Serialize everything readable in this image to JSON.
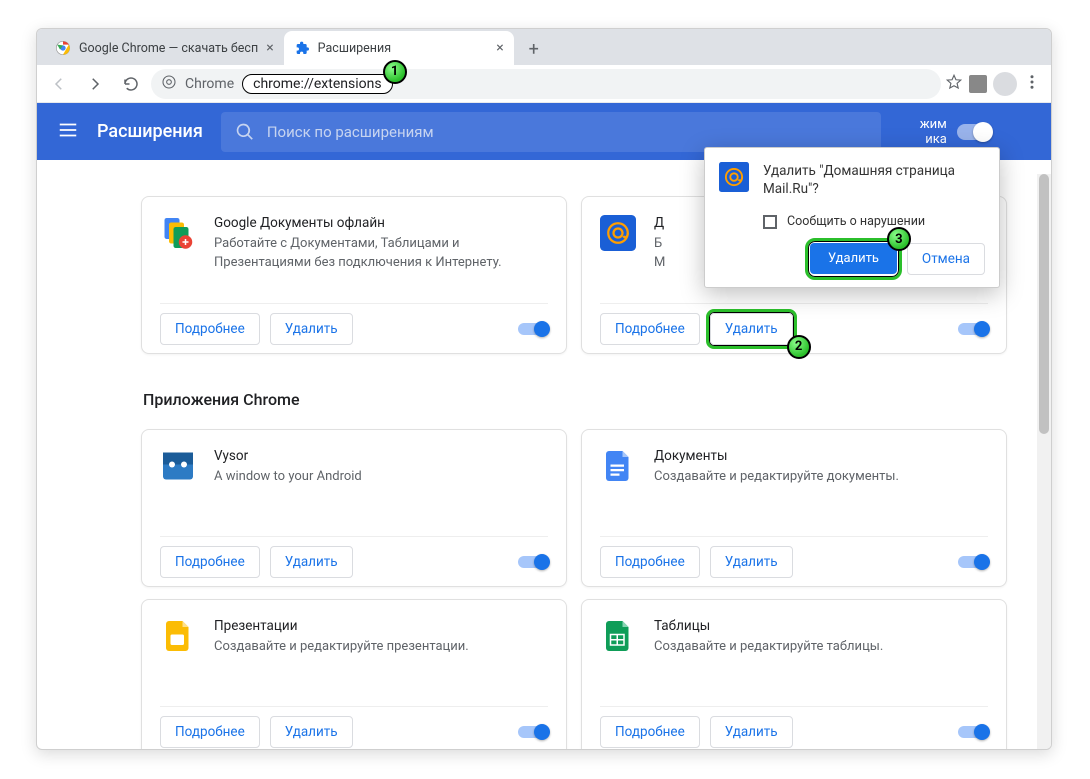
{
  "window": {
    "minimize": "–",
    "maximize": "▢",
    "close": "✕"
  },
  "tabs": [
    {
      "title": "Google Chrome — скачать бесп",
      "favicon": "chrome-multicolor"
    },
    {
      "title": "Расширения",
      "favicon": "puzzle-blue"
    }
  ],
  "toolbar": {
    "chrome_label": "Chrome",
    "url": "chrome://extensions"
  },
  "header": {
    "title": "Расширения",
    "search_placeholder": "Поиск по расширениям",
    "dev_mode_label": "жим\nика"
  },
  "sections": {
    "apps_title": "Приложения Chrome"
  },
  "cards": [
    {
      "title": "Google Документы офлайн",
      "desc": "Работайте с Документами, Таблицами и Презентациями без подключения к Интернету.",
      "details": "Подробнее",
      "remove": "Удалить",
      "iconKind": "gdocs-offline"
    },
    {
      "title": "Д",
      "desc": "Б\nМ",
      "details": "Подробнее",
      "remove": "Удалить",
      "iconKind": "mailru"
    },
    {
      "title": "Vysor",
      "desc": "A window to your Android",
      "details": "Подробнее",
      "remove": "Удалить",
      "iconKind": "vysor"
    },
    {
      "title": "Документы",
      "desc": "Создавайте и редактируйте документы.",
      "details": "Подробнее",
      "remove": "Удалить",
      "iconKind": "gdocs"
    },
    {
      "title": "Презентации",
      "desc": "Создавайте и редактируйте презентации.",
      "details": "Подробнее",
      "remove": "Удалить",
      "iconKind": "gslides"
    },
    {
      "title": "Таблицы",
      "desc": "Создавайте и редактируйте таблицы.",
      "details": "Подробнее",
      "remove": "Удалить",
      "iconKind": "gsheets"
    }
  ],
  "dialog": {
    "title": "Удалить \"Домашняя страница Mail.Ru\"?",
    "report": "Сообщить о нарушении",
    "remove": "Удалить",
    "cancel": "Отмена"
  },
  "badges": {
    "one": "1",
    "two": "2",
    "three": "3"
  }
}
